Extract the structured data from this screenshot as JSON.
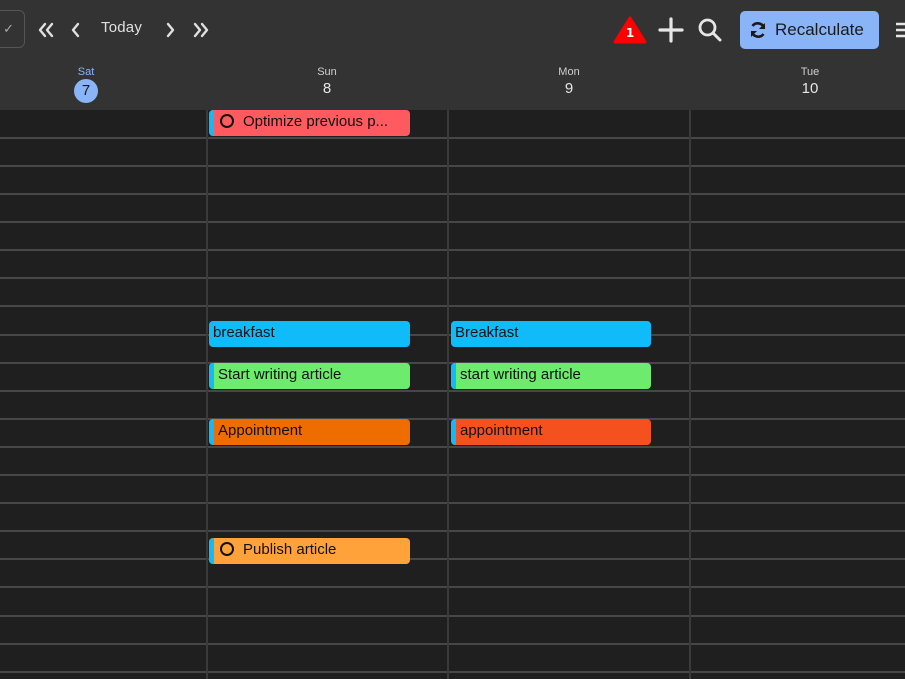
{
  "toolbar": {
    "check_icon": "check-icon",
    "prev_week_icon": "double-chevron-left-icon",
    "prev_icon": "chevron-left-icon",
    "today_label": "Today",
    "next_icon": "chevron-right-icon",
    "next_week_icon": "double-chevron-right-icon",
    "warning_count": "1",
    "warning_color": "#ff0000",
    "add_icon": "plus-icon",
    "search_icon": "search-icon",
    "recalculate_label": "Recalculate",
    "recalculate_color": "#8ab4f8",
    "menu_icon": "hamburger-menu-icon"
  },
  "days": [
    {
      "name": "Sat",
      "number": "7",
      "is_today": true
    },
    {
      "name": "Sun",
      "number": "8",
      "is_today": false
    },
    {
      "name": "Mon",
      "number": "9",
      "is_today": false
    },
    {
      "name": "Tue",
      "number": "10",
      "is_today": false
    }
  ],
  "events": [
    {
      "day": "Sun",
      "title": "Optimize previous p...",
      "color": "#ff5a5f",
      "has_bar": true,
      "is_task": true
    },
    {
      "day": "Sun",
      "title": "breakfast",
      "color": "#0fbcf9",
      "has_bar": false,
      "is_task": false
    },
    {
      "day": "Sun",
      "title": "Start writing article",
      "color": "#6ceb6c",
      "has_bar": true,
      "is_task": false
    },
    {
      "day": "Sun",
      "title": "Appointment",
      "color": "#ef6c00",
      "has_bar": true,
      "is_task": false
    },
    {
      "day": "Sun",
      "title": "Publish article",
      "color": "#ffa23a",
      "has_bar": true,
      "is_task": true
    },
    {
      "day": "Mon",
      "title": "Breakfast",
      "color": "#0fbcf9",
      "has_bar": false,
      "is_task": false
    },
    {
      "day": "Mon",
      "title": "start writing article",
      "color": "#6ceb6c",
      "has_bar": true,
      "is_task": false
    },
    {
      "day": "Mon",
      "title": "appointment",
      "color": "#f4511e",
      "has_bar": true,
      "is_task": false
    }
  ],
  "accent_bar_color": "#0fbcf9"
}
